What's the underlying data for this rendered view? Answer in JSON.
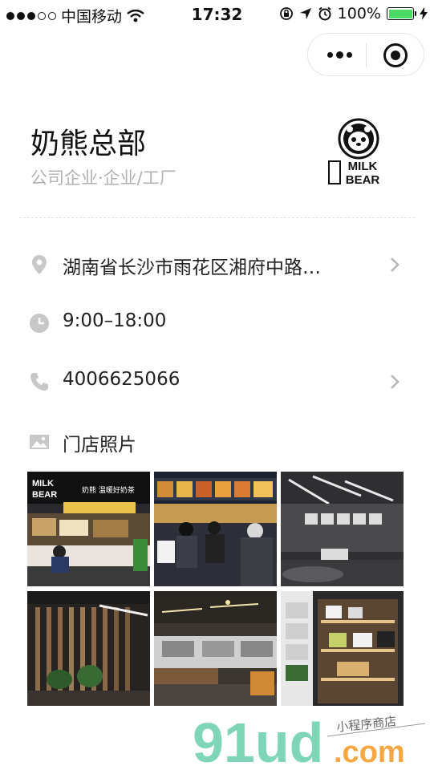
{
  "status_bar": {
    "carrier": "中国移动",
    "time": "17:32",
    "battery": "100%",
    "battery_level": 1.0,
    "signal_bars_filled": 3,
    "signal_bars_total": 5
  },
  "store": {
    "name": "奶熊总部",
    "category": "公司企业·企业/工厂",
    "logo_text_top": "MILK",
    "logo_text_bottom": "BEAR"
  },
  "info": {
    "address": "湖南省长沙市雨花区湘府中路…",
    "hours": "9:00–18:00",
    "phone": "4006625066",
    "photos_label": "门店照片"
  },
  "photos": [
    {
      "sign_top": "MILK",
      "sign_bottom": "BEAR",
      "sign_right": "奶熊 温暖好奶茶"
    },
    {},
    {},
    {},
    {},
    {}
  ],
  "watermark": {
    "main": "91ud",
    "domain": ".com",
    "tagline": "小程序商店"
  },
  "colors": {
    "battery_fill": "#4cd964",
    "secondary_text": "#b2b2b2",
    "icon_gray": "#c8c8c8",
    "watermark_green": "#7ed6b6",
    "watermark_orange": "#f4a742"
  }
}
